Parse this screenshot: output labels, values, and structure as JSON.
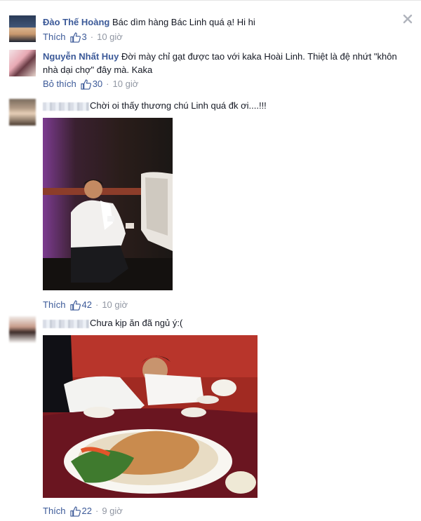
{
  "comments": [
    {
      "author": "Đào Thế Hoàng",
      "text": "Bác dìm hàng Bác Linh quá ạ! Hi hi",
      "action": "Thích",
      "likes": "3",
      "time": "10 giờ"
    },
    {
      "author": "Nguyễn Nhất Huy",
      "text": "Đời mày chỉ gạt được tao với kaka Hoài Linh. Thiệt là đệ nhứt \"khôn nhà dại chợ\" đây mà. Kaka",
      "action": "Bỏ thích",
      "likes": "30",
      "time": "10 giờ"
    },
    {
      "author": "",
      "text": "Chời oi thấy thương chú Linh quá đk ơi....!!!",
      "action": "Thích",
      "likes": "42",
      "time": "10 giờ"
    },
    {
      "author": "",
      "text": "Chưa kịp ăn đã ngủ ý:(",
      "action": "Thích",
      "likes": "22",
      "time": "9 giờ"
    }
  ],
  "colors": {
    "link": "#3b5998",
    "meta": "#9197a3",
    "text": "#141823"
  },
  "icons": [
    "close-icon",
    "thumbs-up-icon"
  ]
}
